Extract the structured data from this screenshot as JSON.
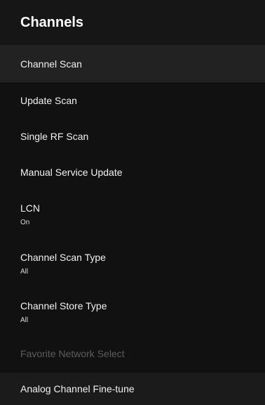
{
  "header": {
    "title": "Channels"
  },
  "menu": {
    "items": [
      {
        "label": "Channel Scan"
      },
      {
        "label": "Update Scan"
      },
      {
        "label": "Single RF Scan"
      },
      {
        "label": "Manual Service Update"
      },
      {
        "label": "LCN",
        "value": "On"
      },
      {
        "label": "Channel Scan Type",
        "value": "All"
      },
      {
        "label": "Channel Store Type",
        "value": "All"
      },
      {
        "label": "Favorite Network Select"
      },
      {
        "label": "Analog Channel Fine-tune"
      }
    ]
  }
}
